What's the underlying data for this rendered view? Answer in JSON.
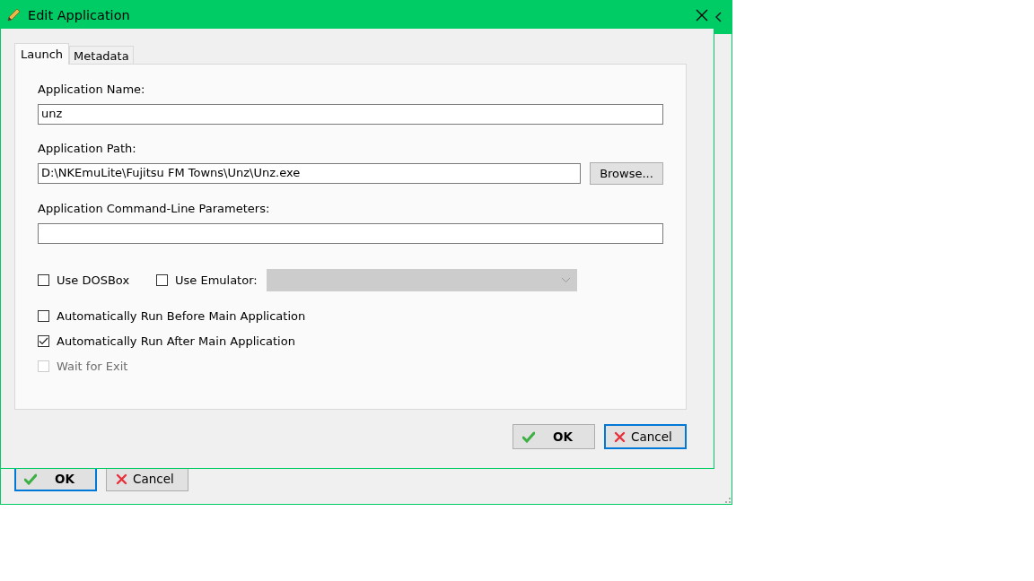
{
  "background_window": {
    "buttons": [
      {
        "label": "OK",
        "kind": "ok",
        "default": true
      },
      {
        "label": "Cancel",
        "kind": "cancel",
        "default": false
      }
    ]
  },
  "dialog": {
    "title": "Edit Application",
    "tabs": [
      {
        "label": "Launch",
        "selected": true
      },
      {
        "label": "Metadata",
        "selected": false
      }
    ],
    "fields": [
      {
        "label": "Application Name:",
        "value": "unz"
      },
      {
        "label": "Application Path:",
        "value": "D:\\NKEmuLite\\Fujitsu FM Towns\\Unz\\Unz.exe",
        "button": "Browse..."
      },
      {
        "label": "Application Command-Line Parameters:"
      }
    ],
    "inline_options": [
      {
        "kind": "checkbox",
        "label": "Use DOSBox",
        "checked": false
      },
      {
        "kind": "dropdown",
        "label": "Use Emulator:",
        "checked": false,
        "disabled": true
      }
    ],
    "options": [
      {
        "label": "Automatically Run Before Main Application",
        "checked": false,
        "disabled": false
      },
      {
        "label": "Automatically Run After Main Application",
        "checked": true,
        "disabled": false
      },
      {
        "label": "Wait for Exit",
        "checked": false,
        "disabled": true
      }
    ],
    "buttons": [
      {
        "label": "OK",
        "kind": "ok",
        "default": false
      },
      {
        "label": "Cancel",
        "kind": "cancel",
        "default": true
      }
    ]
  }
}
